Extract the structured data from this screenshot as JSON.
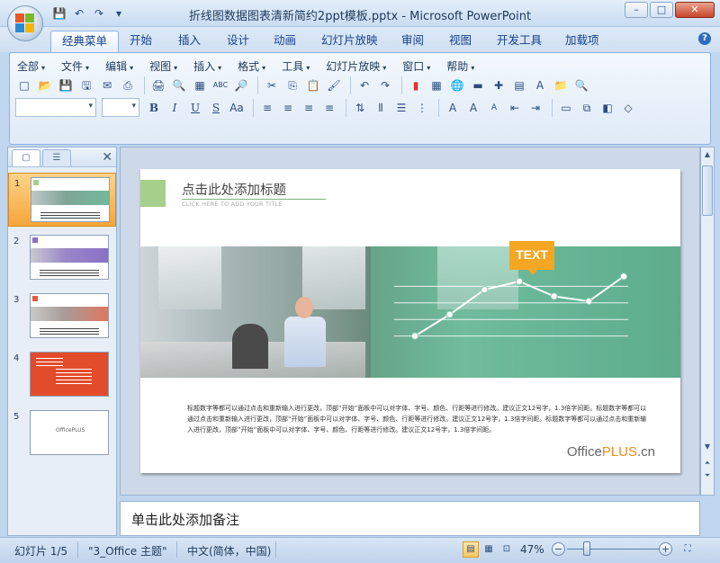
{
  "window": {
    "title": "折线图数据图表清新简约2ppt模板.pptx - Microsoft PowerPoint",
    "controls": {
      "minimize": "–",
      "maximize": "□",
      "close": "✕"
    }
  },
  "quick_access": [
    {
      "name": "save-icon",
      "glyph": "💾"
    },
    {
      "name": "undo-icon",
      "glyph": "↶"
    },
    {
      "name": "redo-icon",
      "glyph": "↷"
    },
    {
      "name": "customize-qat-icon",
      "glyph": "▾"
    }
  ],
  "ribbon_tabs": [
    "经典菜单",
    "开始",
    "插入",
    "设计",
    "动画",
    "幻灯片放映",
    "审阅",
    "视图",
    "开发工具",
    "加载项"
  ],
  "active_tab": "经典菜单",
  "classic_menus": [
    "全部",
    "文件",
    "编辑",
    "视图",
    "插入",
    "格式",
    "工具",
    "幻灯片放映",
    "窗口",
    "帮助"
  ],
  "toolbar_row1": [
    "□",
    "📂",
    "💾",
    "🖫",
    "✉",
    "⎙",
    "🖨",
    "🔍",
    "▦",
    "ABC",
    "🔎",
    "✂",
    "⎘",
    "📋",
    "🖌",
    "↶",
    "↷",
    "▮",
    "▦",
    "🌐",
    "▬",
    "✚",
    "▤",
    "A",
    "📁",
    "🔍"
  ],
  "toolbar_row2": {
    "bold": "B",
    "italic": "I",
    "underline": "U",
    "strike": "S",
    "case": "Aa",
    "align": [
      "≡",
      "≡",
      "≡",
      "≡"
    ],
    "font_color": "A",
    "grow_font": "A",
    "shrink_font": "A"
  },
  "slides_pane": {
    "tabs": [
      "▢",
      "☰"
    ],
    "close": "✕",
    "thumbnails": [
      {
        "number": "1",
        "selected": true
      },
      {
        "number": "2",
        "selected": false
      },
      {
        "number": "3",
        "selected": false
      },
      {
        "number": "4",
        "selected": false
      },
      {
        "number": "5",
        "selected": false,
        "text": "OfficePLUS"
      }
    ]
  },
  "slide": {
    "title": "点击此处添加标题",
    "subtitle": "CLICK HERE TO ADD YOUR TITLE",
    "badge": "TEXT",
    "body": "标题数字等都可以通过点击和重新输入进行更改，顶部“开始”面板中可以对字体、字号、颜色、行距等进行修改。建议正文12号字，1.3倍字间距。标题数字等都可以通过点击和重新输入进行更改，顶部“开始”面板中可以对字体、字号、颜色、行距等进行修改。建议正文12号字，1.3倍字间距。标题数字等都可以通过点击和重新输入进行更改，顶部“开始”面板中可以对字体、字号、颜色、行距等进行修改。建议正文12号字，1.3倍字间距。",
    "brand_left": "Office",
    "brand_plus": "PLUS",
    "brand_right": ".cn",
    "colors": {
      "accent": "#a5cf8a",
      "badge": "#f5a623",
      "plus": "#f08c1e"
    }
  },
  "chart_data": {
    "type": "line",
    "x": [
      1,
      2,
      3,
      4,
      5,
      6,
      7
    ],
    "values": [
      1.0,
      2.3,
      3.8,
      4.3,
      3.4,
      3.1,
      4.6
    ],
    "ylim": [
      0,
      5
    ],
    "grid": true,
    "title": "",
    "xlabel": "",
    "ylabel": ""
  },
  "notes": {
    "placeholder": "单击此处添加备注"
  },
  "statusbar": {
    "slide_info": "幻灯片 1/5",
    "theme": "\"3_Office 主题\"",
    "language": "中文(简体，中国)",
    "zoom": "47%",
    "zoom_level": 0.47
  }
}
